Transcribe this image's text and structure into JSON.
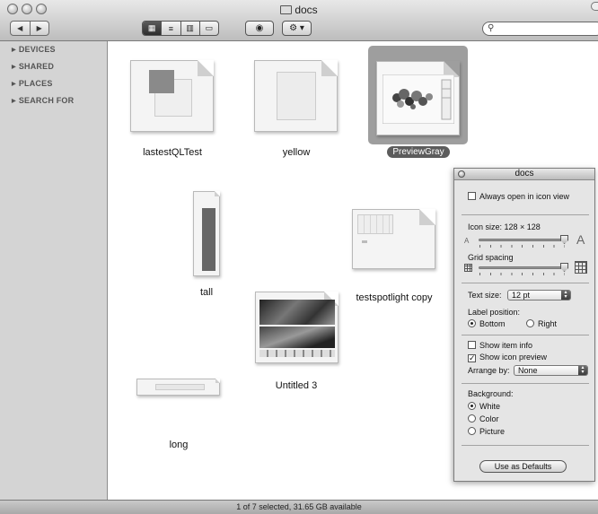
{
  "window": {
    "title": "docs"
  },
  "toolbar": {
    "back_label": "◀",
    "forward_label": "▶",
    "view_icons_label": "▦",
    "view_list_label": "≡",
    "view_columns_label": "▥",
    "view_coverflow_label": "▭",
    "quicklook_label": "◉",
    "action_label": "⚙ ▾",
    "search_placeholder": "",
    "search_icon": "⚲"
  },
  "sidebar": {
    "items": [
      {
        "label": "DEVICES"
      },
      {
        "label": "SHARED"
      },
      {
        "label": "PLACES"
      },
      {
        "label": "SEARCH FOR"
      }
    ]
  },
  "files": [
    {
      "name": "lastestQLTest"
    },
    {
      "name": "yellow"
    },
    {
      "name": "PreviewGray",
      "selected": true
    },
    {
      "name": "tall"
    },
    {
      "name": "testspotlight copy"
    },
    {
      "name": "Untitled 3"
    },
    {
      "name": "long"
    }
  ],
  "status": {
    "text": "1 of 7 selected, 31.65 GB available"
  },
  "view_options": {
    "title": "docs",
    "always_open_label": "Always open in icon view",
    "always_open_checked": false,
    "icon_size_label": "Icon size: 128 × 128",
    "icon_size_fraction": 1.0,
    "small_a": "A",
    "big_a": "A",
    "grid_spacing_label": "Grid spacing",
    "grid_spacing_fraction": 1.0,
    "text_size_label": "Text size:",
    "text_size_value": "12 pt",
    "label_position_label": "Label position:",
    "label_bottom": "Bottom",
    "label_right": "Right",
    "label_position_selected": "Bottom",
    "show_item_info_label": "Show item info",
    "show_item_info_checked": false,
    "show_icon_preview_label": "Show icon preview",
    "show_icon_preview_checked": true,
    "arrange_by_label": "Arrange by:",
    "arrange_by_value": "None",
    "background_label": "Background:",
    "bg_white": "White",
    "bg_color": "Color",
    "bg_picture": "Picture",
    "background_selected": "White",
    "defaults_button": "Use as Defaults"
  }
}
